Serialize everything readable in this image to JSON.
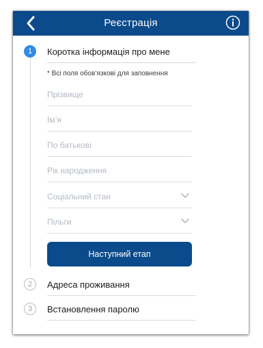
{
  "header": {
    "title": "Реєстрація",
    "back_icon": "chevron-left-icon",
    "info_icon": "info-icon"
  },
  "steps": [
    {
      "number": "1",
      "title": "Коротка інформація про мене"
    },
    {
      "number": "2",
      "title": "Адреса проживання"
    },
    {
      "number": "3",
      "title": "Встановлення паролю"
    }
  ],
  "form": {
    "required_note": "* Всі поля обов’язкові для заповнення",
    "fields": [
      {
        "placeholder": "Прізвище"
      },
      {
        "placeholder": "Ім’я"
      },
      {
        "placeholder": "По батькові"
      },
      {
        "placeholder": "Рік народження"
      },
      {
        "placeholder": "Соціальний стан"
      },
      {
        "placeholder": "Пільги"
      }
    ],
    "next_button": "Наступний етап"
  },
  "colors": {
    "header_bg": "#0b4a8b",
    "active_step": "#2f8ce6",
    "button_bg": "#0b4a8b"
  }
}
